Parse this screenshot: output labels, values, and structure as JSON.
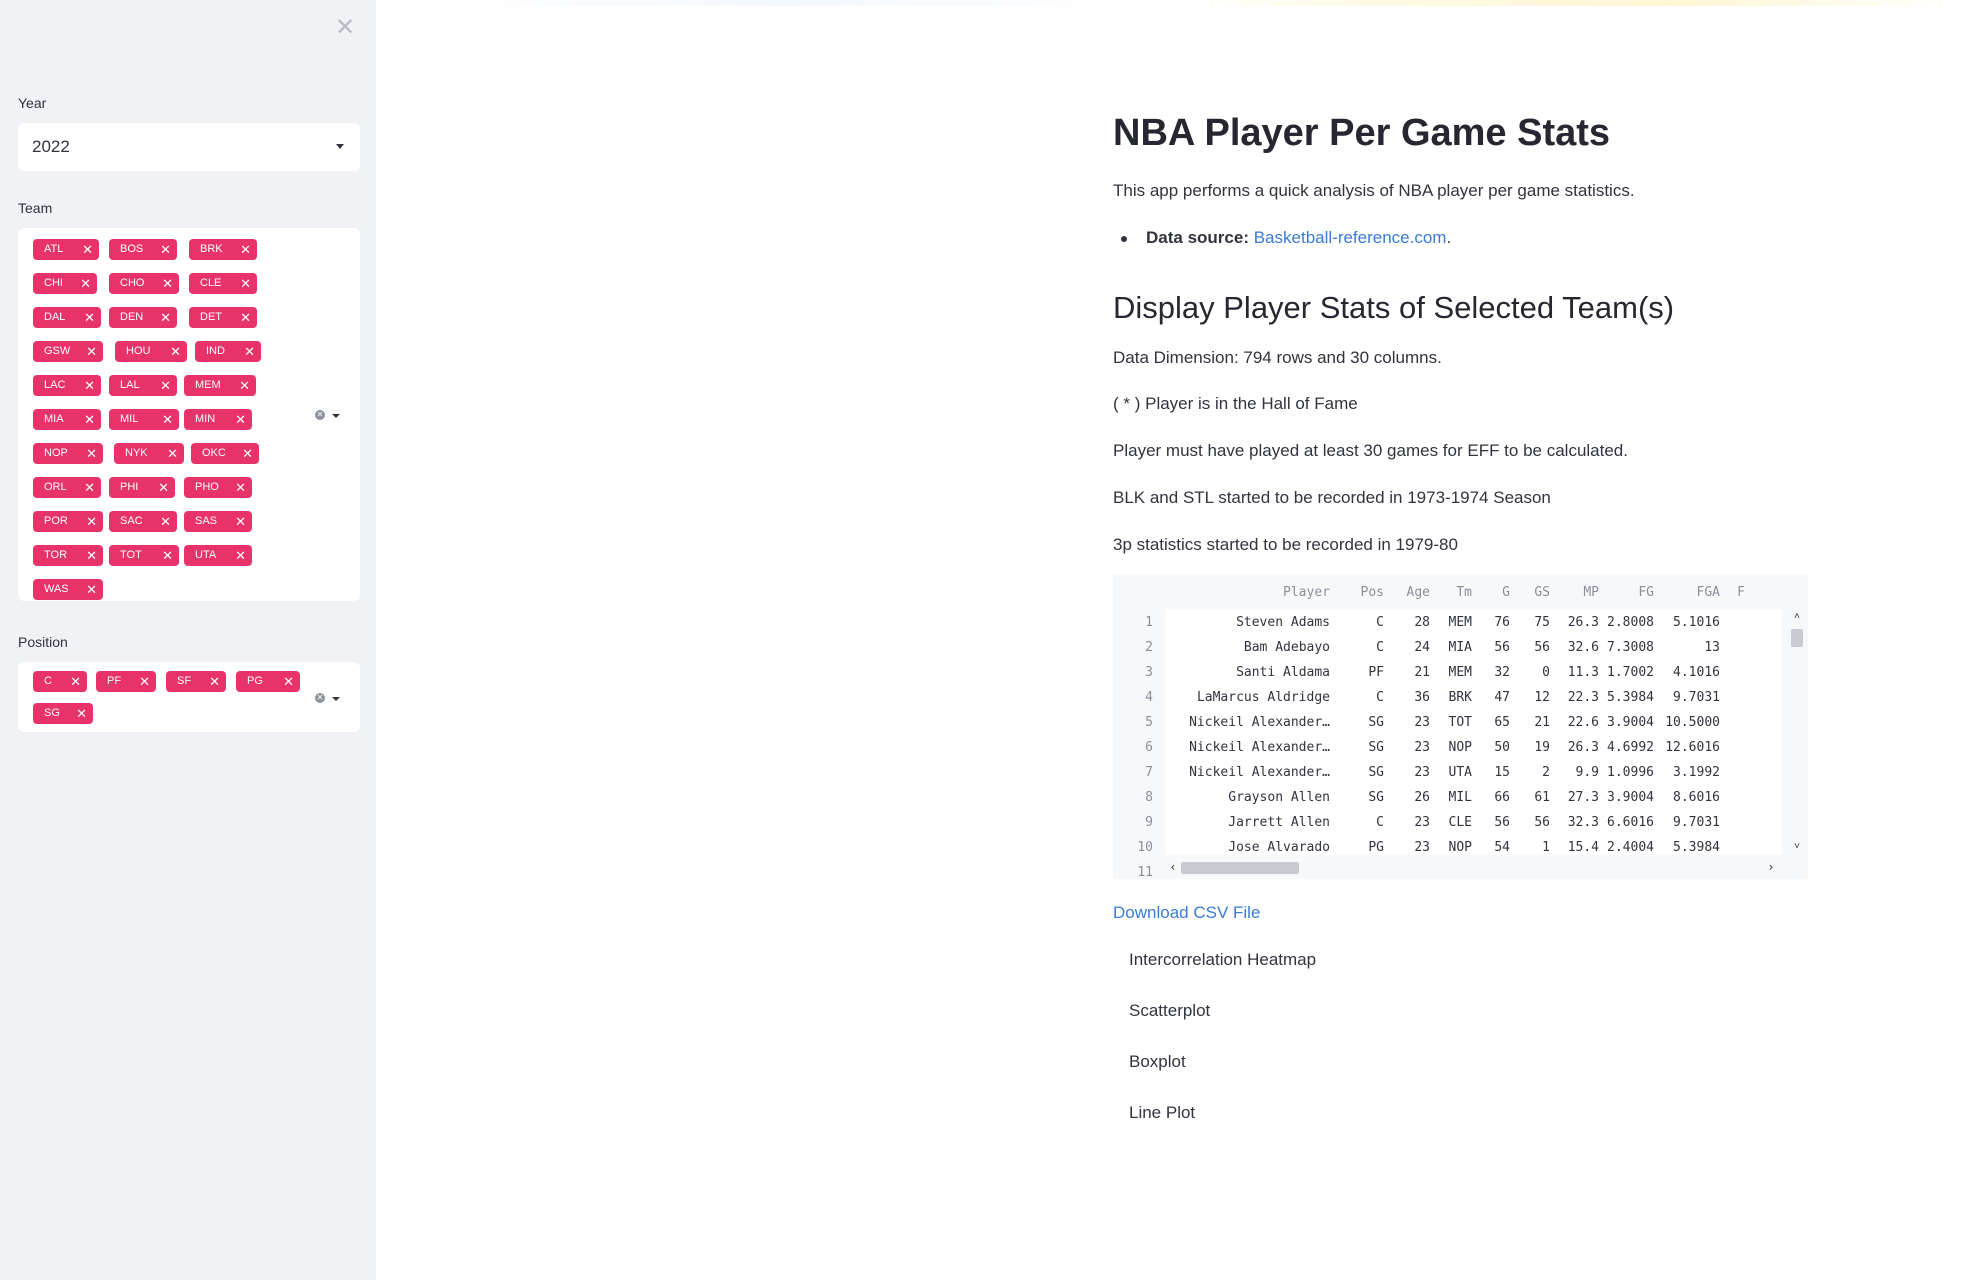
{
  "sidebar": {
    "close_icon": "close-icon",
    "year": {
      "label": "Year",
      "value": "2022"
    },
    "team": {
      "label": "Team",
      "tags": [
        "ATL",
        "BOS",
        "BRK",
        "CHI",
        "CHO",
        "CLE",
        "DAL",
        "DEN",
        "DET",
        "GSW",
        "HOU",
        "IND",
        "LAC",
        "LAL",
        "MEM",
        "MIA",
        "MIL",
        "MIN",
        "NOP",
        "NYK",
        "OKC",
        "ORL",
        "PHI",
        "PHO",
        "POR",
        "SAC",
        "SAS",
        "TOR",
        "TOT",
        "UTA",
        "WAS"
      ]
    },
    "position": {
      "label": "Position",
      "tags": [
        "C",
        "PF",
        "SF",
        "PG",
        "SG"
      ]
    },
    "tag_color": "#e8336a"
  },
  "main": {
    "title": "NBA Player Per Game Stats",
    "intro": "This app performs a quick analysis of NBA player per game statistics.",
    "source_label": "Data source:",
    "source_link": "Basketball-reference.com",
    "source_suffix": ".",
    "section_title": "Display Player Stats of Selected Team(s)",
    "dimension": "Data Dimension: 794 rows and 30 columns.",
    "hof_note": "( * ) Player is in the Hall of Fame",
    "eff_note": "Player must have played at least 30 games for EFF to be calculated.",
    "blk_note": "BLK and STL started to be recorded in 1973-1974 Season",
    "threep_note": "3p statistics started to be recorded in 1979-80",
    "download": "Download CSV File",
    "options": [
      "Intercorrelation Heatmap",
      "Scatterplot",
      "Boxplot",
      "Line Plot"
    ],
    "link_color": "#3a7bd5"
  },
  "table": {
    "columns": [
      "Player",
      "Pos",
      "Age",
      "Tm",
      "G",
      "GS",
      "MP",
      "FG",
      "FGA",
      "F"
    ],
    "rows": [
      [
        "1",
        "Steven Adams",
        "C",
        "28",
        "MEM",
        "76",
        "75",
        "26.3",
        "2.8008",
        "5.1016"
      ],
      [
        "2",
        "Bam Adebayo",
        "C",
        "24",
        "MIA",
        "56",
        "56",
        "32.6",
        "7.3008",
        "13"
      ],
      [
        "3",
        "Santi Aldama",
        "PF",
        "21",
        "MEM",
        "32",
        "0",
        "11.3",
        "1.7002",
        "4.1016"
      ],
      [
        "4",
        "LaMarcus Aldridge",
        "C",
        "36",
        "BRK",
        "47",
        "12",
        "22.3",
        "5.3984",
        "9.7031"
      ],
      [
        "5",
        "Nickeil Alexander…",
        "SG",
        "23",
        "TOT",
        "65",
        "21",
        "22.6",
        "3.9004",
        "10.5000"
      ],
      [
        "6",
        "Nickeil Alexander…",
        "SG",
        "23",
        "NOP",
        "50",
        "19",
        "26.3",
        "4.6992",
        "12.6016"
      ],
      [
        "7",
        "Nickeil Alexander…",
        "SG",
        "23",
        "UTA",
        "15",
        "2",
        "9.9",
        "1.0996",
        "3.1992"
      ],
      [
        "8",
        "Grayson Allen",
        "SG",
        "26",
        "MIL",
        "66",
        "61",
        "27.3",
        "3.9004",
        "8.6016"
      ],
      [
        "9",
        "Jarrett Allen",
        "C",
        "23",
        "CLE",
        "56",
        "56",
        "32.3",
        "6.6016",
        "9.7031"
      ],
      [
        "10",
        "Jose Alvarado",
        "PG",
        "23",
        "NOP",
        "54",
        "1",
        "15.4",
        "2.4004",
        "5.3984"
      ]
    ],
    "next_index": "11"
  }
}
